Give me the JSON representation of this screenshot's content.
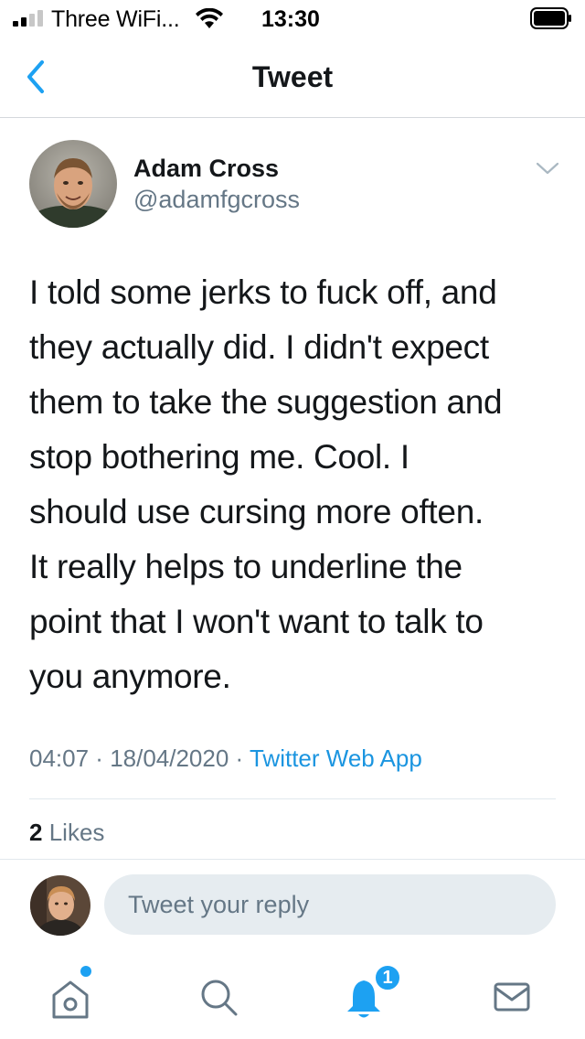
{
  "status_bar": {
    "carrier": "Three WiFi...",
    "time": "13:30",
    "icons": [
      "signal-icon",
      "wifi-icon",
      "battery-icon"
    ]
  },
  "header": {
    "title": "Tweet",
    "back_icon": "chevron-left-icon"
  },
  "tweet": {
    "author_name": "Adam Cross",
    "author_handle": "@adamfgcross",
    "menu_icon": "chevron-down-icon",
    "text_lines": [
      "I told some jerks to fuck off, and",
      "they actually did.  I didn't expect",
      "them to take the suggestion and",
      "stop bothering me.  Cool.  I",
      "should use cursing more often.",
      "It really helps to underline the",
      "point that I won't want to talk to",
      "you anymore."
    ],
    "time": "04:07",
    "date": "18/04/2020",
    "separator": " · ",
    "source": "Twitter Web App",
    "likes_count": "2",
    "likes_label": "Likes"
  },
  "reply": {
    "placeholder": "Tweet your reply"
  },
  "tabbar": {
    "tabs": [
      "home-icon",
      "search-icon",
      "notifications-icon",
      "messages-icon"
    ],
    "notification_badge": "1"
  },
  "colors": {
    "accent": "#1da1f2",
    "link": "#1b95e0",
    "secondary_text": "#657786",
    "primary_text": "#14171a",
    "reply_box": "#e6ecf0"
  }
}
